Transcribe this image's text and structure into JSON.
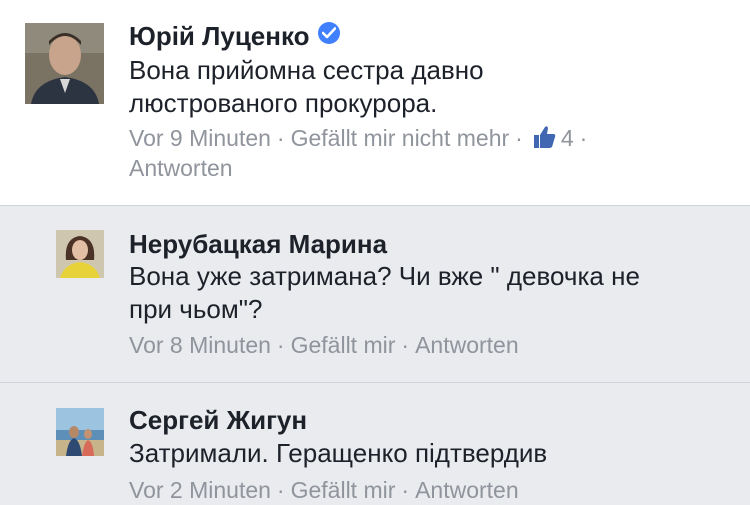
{
  "comments": [
    {
      "author": "Юрій Луценко",
      "verified": true,
      "text": "Вона прийомна сестра давно\nлюстрованого прокурора.",
      "time": "Vor 9 Minuten",
      "like_action": "Gefällt mir nicht mehr",
      "like_count": "4",
      "reply": "Antworten"
    },
    {
      "author": "Нерубацкая Марина",
      "text": "Вона уже затримана? Чи вже \" девочка не\nпри чьом\"?",
      "time": "Vor 8 Minuten",
      "like_action": "Gefällt mir",
      "reply": "Antworten"
    },
    {
      "author": "Сергей Жигун",
      "text": "Затримали. Геращенко підтвердив",
      "time": "Vor 2 Minuten",
      "like_action": "Gefällt mir",
      "reply": "Antworten"
    }
  ],
  "separator": "·",
  "icons": {
    "verified": "verified-badge-icon",
    "like": "thumbs-up-icon"
  },
  "colors": {
    "name": "#1d2129",
    "meta": "#90949c",
    "verified_blue": "#4080ff",
    "like_blue": "#4267b2",
    "reply_bg": "#e9ebee"
  }
}
